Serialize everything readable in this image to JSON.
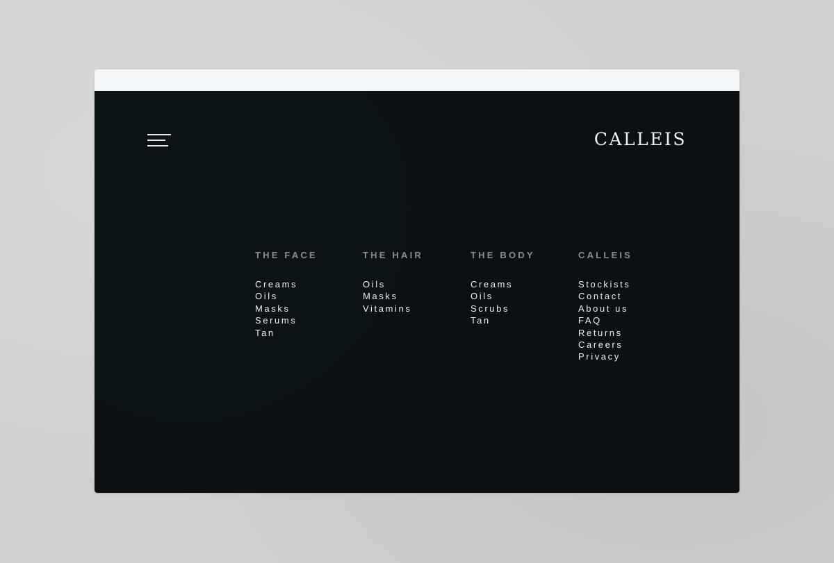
{
  "brand": {
    "logo_text": "CALLEIS"
  },
  "nav": {
    "menu_icon": "hamburger-menu-icon"
  },
  "menu": {
    "columns": [
      {
        "heading": "THE FACE",
        "items": [
          "Creams",
          "Oils",
          "Masks",
          "Serums",
          "Tan"
        ]
      },
      {
        "heading": "THE HAIR",
        "items": [
          "Oils",
          "Masks",
          "Vitamins"
        ]
      },
      {
        "heading": "THE BODY",
        "items": [
          "Creams",
          "Oils",
          "Scrubs",
          "Tan"
        ]
      },
      {
        "heading": "CALLEIS",
        "items": [
          "Stockists",
          "Contact",
          "About us",
          "FAQ",
          "Returns",
          "Careers",
          "Privacy"
        ]
      }
    ]
  },
  "colors": {
    "page_background": "#0a1014",
    "window_chrome": "#f3f6f9",
    "heading_text": "#8b8e91",
    "link_text": "#f0f0f0"
  }
}
